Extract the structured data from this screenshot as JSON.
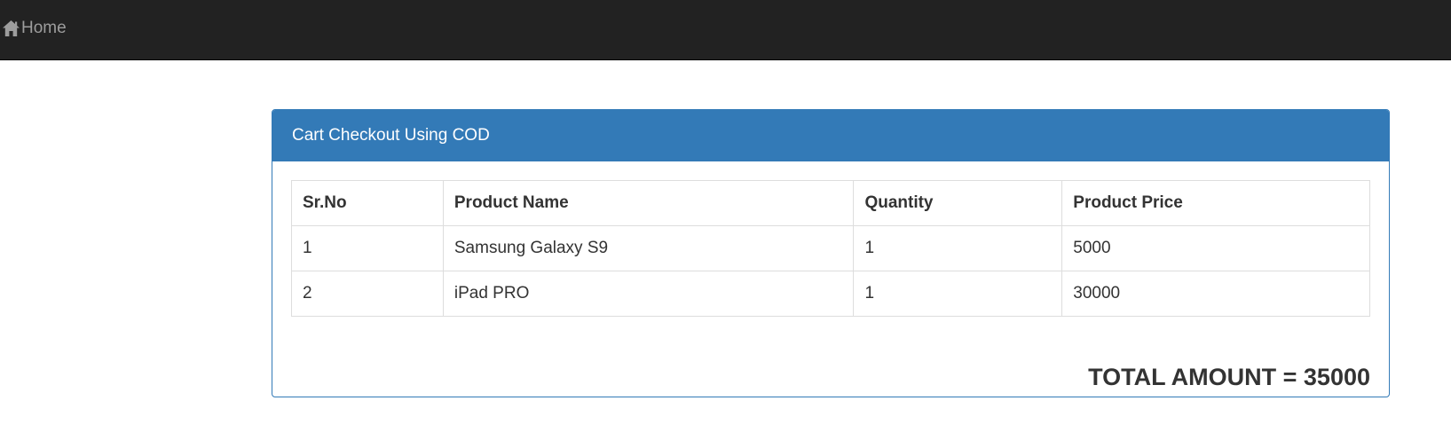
{
  "navbar": {
    "home_label": "Home",
    "home_icon": "home-icon",
    "background": "#222222",
    "link_color": "#9d9d9d"
  },
  "panel": {
    "title": "Cart Checkout Using COD",
    "accent": "#337ab7"
  },
  "table": {
    "headers": [
      "Sr.No",
      "Product Name",
      "Quantity",
      "Product Price"
    ],
    "rows": [
      [
        "1",
        "Samsung Galaxy S9",
        "1",
        "5000"
      ],
      [
        "2",
        "iPad PRO",
        "1",
        "30000"
      ]
    ]
  },
  "total": {
    "text": "TOTAL AMOUNT = 35000"
  }
}
